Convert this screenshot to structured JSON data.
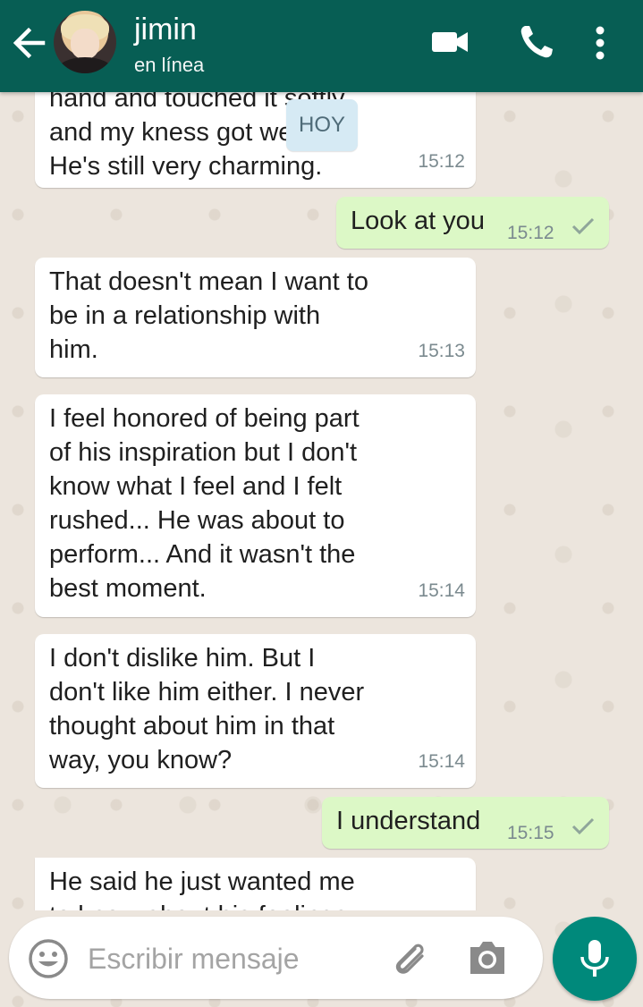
{
  "header": {
    "contact_name": "jimin",
    "status": "en línea"
  },
  "date_badge": "HOY",
  "messages": [
    {
      "direction": "in",
      "text": "hand and touched it softly and my kness got weak. He's still very charming.",
      "lines": [
        "hand and touched it softly",
        "and my kness got weak.",
        "He's still very charming."
      ],
      "time": "15:12"
    },
    {
      "direction": "out",
      "text": "Look at you",
      "time": "15:12",
      "status": "sent"
    },
    {
      "direction": "in",
      "lines": [
        "That doesn't mean I want to",
        "be in a relationship with",
        "him."
      ],
      "time": "15:13"
    },
    {
      "direction": "in",
      "lines": [
        "I feel honored of being part",
        "of his inspiration but I don't",
        "know what I feel and I felt",
        "rushed... He was about to",
        "perform... And it wasn't the",
        "best moment."
      ],
      "time": "15:14"
    },
    {
      "direction": "in",
      "lines": [
        "I don't dislike him. But I",
        "don't like him either. I never",
        "thought about him in that",
        "way, you know?"
      ],
      "time": "15:14"
    },
    {
      "direction": "out",
      "text": "I understand",
      "time": "15:15",
      "status": "sent"
    },
    {
      "direction": "in",
      "lines": [
        "He said he just wanted me",
        "to know about his feelings"
      ],
      "time": ""
    }
  ],
  "composer": {
    "placeholder": "Escribir mensaje"
  },
  "icons": {
    "back": "arrow-left-icon",
    "video": "video-camera-icon",
    "call": "phone-icon",
    "menu": "more-vert-icon",
    "emoji": "emoji-icon",
    "attach": "paperclip-icon",
    "camera": "camera-icon",
    "mic": "microphone-icon",
    "check": "check-icon"
  },
  "colors": {
    "header": "#075e54",
    "chat_background": "#ece5dd",
    "incoming": "#ffffff",
    "outgoing": "#dcf8c6",
    "mic_button": "#00897b",
    "date_badge": "#d6eaf4"
  }
}
